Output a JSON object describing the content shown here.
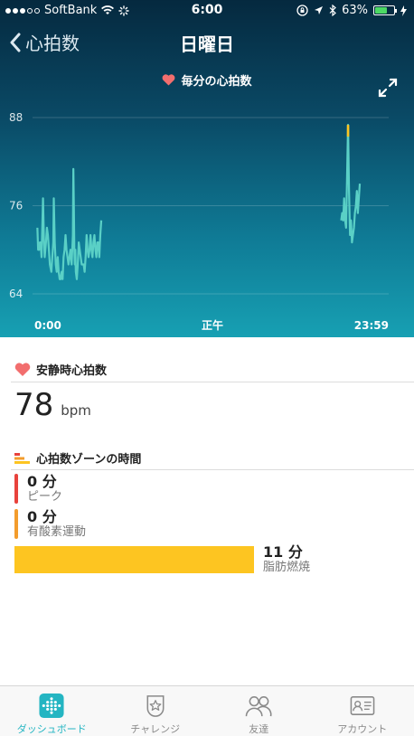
{
  "status_bar": {
    "carrier": "SoftBank",
    "time": "6:00",
    "battery_percent": "63%",
    "battery_level": 0.63,
    "signal_bars": 3
  },
  "nav": {
    "back_label": "心拍数",
    "title": "日曜日"
  },
  "chart": {
    "legend_label": "毎分の心拍数",
    "x_labels": [
      "0:00",
      "正午",
      "23:59"
    ],
    "y_labels": [
      "88",
      "76",
      "64"
    ]
  },
  "chart_data": {
    "type": "line",
    "title": "毎分の心拍数",
    "xlim": [
      0,
      1440
    ],
    "ylim": [
      64,
      88
    ],
    "yticks": [
      64,
      76,
      88
    ],
    "grid": true,
    "series": [
      {
        "segments": [
          [
            [
              5,
              73
            ],
            [
              8,
              70
            ],
            [
              12,
              70
            ],
            [
              15,
              71
            ],
            [
              18,
              71
            ],
            [
              22,
              69
            ],
            [
              25,
              73
            ],
            [
              28,
              77
            ],
            [
              32,
              71
            ],
            [
              35,
              69
            ],
            [
              40,
              71
            ],
            [
              44,
              73
            ],
            [
              48,
              72
            ],
            [
              52,
              70
            ],
            [
              56,
              68
            ],
            [
              62,
              67
            ],
            [
              66,
              69
            ],
            [
              70,
              71
            ],
            [
              72,
              77
            ],
            [
              76,
              71
            ],
            [
              80,
              68
            ],
            [
              84,
              67
            ],
            [
              88,
              69
            ],
            [
              92,
              67
            ],
            [
              96,
              66
            ],
            [
              100,
              66
            ],
            [
              104,
              67
            ],
            [
              108,
              66
            ],
            [
              112,
              69
            ],
            [
              116,
              70
            ],
            [
              120,
              72
            ],
            [
              124,
              70
            ],
            [
              128,
              69
            ],
            [
              132,
              68
            ],
            [
              136,
              69
            ],
            [
              140,
              70
            ],
            [
              145,
              68
            ],
            [
              150,
              72
            ],
            [
              152,
              81
            ],
            [
              154,
              76
            ],
            [
              156,
              70
            ],
            [
              158,
              68
            ],
            [
              160,
              70
            ],
            [
              162,
              67
            ],
            [
              166,
              66
            ],
            [
              170,
              68
            ],
            [
              174,
              71
            ],
            [
              178,
              70
            ],
            [
              182,
              69
            ],
            [
              186,
              68
            ],
            [
              190,
              68
            ],
            [
              194,
              68
            ],
            [
              198,
              67
            ],
            [
              202,
              69
            ],
            [
              206,
              72
            ],
            [
              210,
              70
            ],
            [
              214,
              69
            ],
            [
              218,
              70
            ],
            [
              222,
              72
            ],
            [
              226,
              70
            ],
            [
              230,
              69
            ],
            [
              234,
              71
            ],
            [
              238,
              72
            ],
            [
              242,
              70
            ],
            [
              246,
              69
            ],
            [
              250,
              71
            ],
            [
              254,
              71
            ],
            [
              258,
              69
            ],
            [
              262,
              72
            ],
            [
              266,
              74
            ]
          ]
        ]
      },
      {
        "segments": [
          [
            [
              1246,
              74
            ],
            [
              1250,
              75
            ],
            [
              1254,
              74
            ],
            [
              1258,
              77
            ],
            [
              1262,
              74
            ],
            [
              1266,
              73
            ],
            [
              1270,
              80
            ],
            [
              1274,
              87
            ],
            [
              1278,
              78
            ],
            [
              1282,
              72
            ],
            [
              1286,
              74
            ],
            [
              1290,
              71
            ],
            [
              1294,
              72
            ],
            [
              1298,
              73
            ],
            [
              1302,
              75
            ],
            [
              1306,
              76
            ],
            [
              1310,
              78
            ],
            [
              1314,
              75
            ],
            [
              1318,
              77
            ],
            [
              1322,
              79
            ]
          ]
        ]
      }
    ]
  },
  "resting_hr": {
    "title": "安静時心拍数",
    "value": "78",
    "unit": "bpm"
  },
  "zones": {
    "title": "心拍数ゾーンの時間",
    "peak": {
      "value": "0 分",
      "label": "ピーク",
      "color": "#e8423c"
    },
    "cardio": {
      "value": "0 分",
      "label": "有酸素運動",
      "color": "#f39c2c"
    },
    "fat_burn": {
      "value": "11 分",
      "label": "脂肪燃焼",
      "color": "#fdc521"
    }
  },
  "tabs": [
    {
      "label": "ダッシュボード",
      "icon": "dashboard-icon",
      "active": true
    },
    {
      "label": "チャレンジ",
      "icon": "challenge-icon",
      "active": false
    },
    {
      "label": "友達",
      "icon": "friends-icon",
      "active": false
    },
    {
      "label": "アカウント",
      "icon": "account-icon",
      "active": false
    }
  ],
  "colors": {
    "accent": "#24b5c2",
    "line": "#5ad0c6",
    "highlight": "#fdc521",
    "heart": "#f26e6e"
  }
}
